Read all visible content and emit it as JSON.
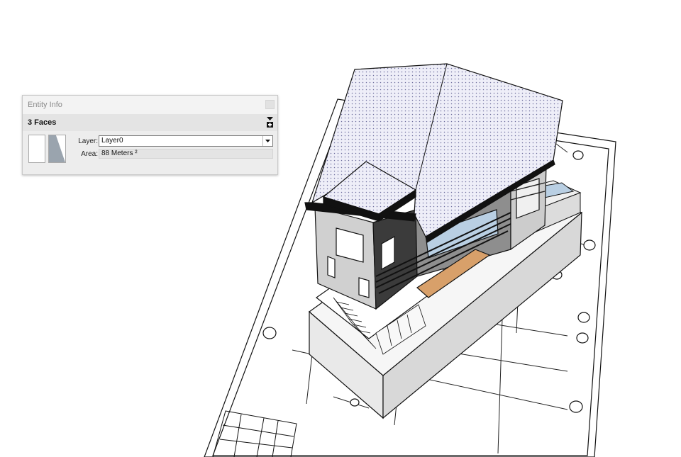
{
  "entity_info": {
    "title": "Entity Info",
    "selection": "3 Faces",
    "layer_label": "Layer:",
    "layer_value": "Layer0",
    "area_label": "Area:",
    "area_value": "88 Meters ²",
    "icons": {
      "close": "close-icon",
      "details": "expand-details-icon",
      "dropdown": "chevron-down-icon"
    }
  },
  "viewport": {
    "model": "3d-house-model",
    "background": "#ffffff",
    "roof_color": "#e6e6f4",
    "wall_dark": "#3b3b3b",
    "deck_color": "#d8a06a",
    "glass_color": "#b9cfe3"
  }
}
